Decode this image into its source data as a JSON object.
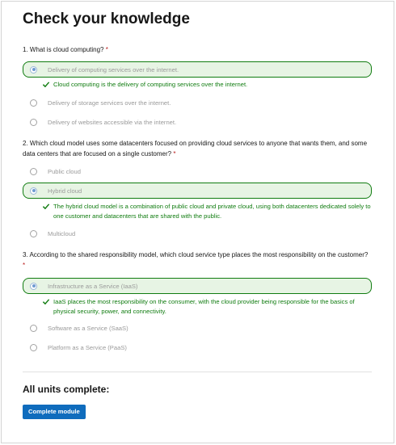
{
  "title": "Check your knowledge",
  "required_mark": "*",
  "questions": [
    {
      "text": "1. What is cloud computing?",
      "options": [
        "Delivery of computing services over the internet.",
        "Delivery of storage services over the internet.",
        "Delivery of websites accessible via the internet."
      ],
      "selected_index": 0,
      "feedback": "Cloud computing is the delivery of computing services over the internet."
    },
    {
      "text": "2. Which cloud model uses some datacenters focused on providing cloud services to anyone that wants them, and some data centers that are focused on a single customer?",
      "options": [
        "Public cloud",
        "Hybrid cloud",
        "Multicloud"
      ],
      "selected_index": 1,
      "feedback": "The hybrid cloud model is a combination of public cloud and private cloud, using both datacenters dedicated solely to one customer and datacenters that are shared with the public."
    },
    {
      "text": "3. According to the shared responsibility model, which cloud service type places the most responsibility on the customer?",
      "options": [
        "Infrastructure as a Service (IaaS)",
        "Software as a Service (SaaS)",
        "Platform as a Service (PaaS)"
      ],
      "selected_index": 0,
      "feedback": "IaaS places the most responsibility on the consumer, with the cloud provider being responsible for the basics of physical security, power, and connectivity."
    }
  ],
  "completion": {
    "heading": "All units complete:",
    "button_label": "Complete module"
  },
  "colors": {
    "correct_border": "#107c10",
    "correct_bg": "#e7f4e4",
    "primary": "#0f6cbd",
    "required": "#b91c1c"
  },
  "icons": {
    "feedback": "checkmark-icon",
    "selected_radio": "radio-selected-icon"
  }
}
